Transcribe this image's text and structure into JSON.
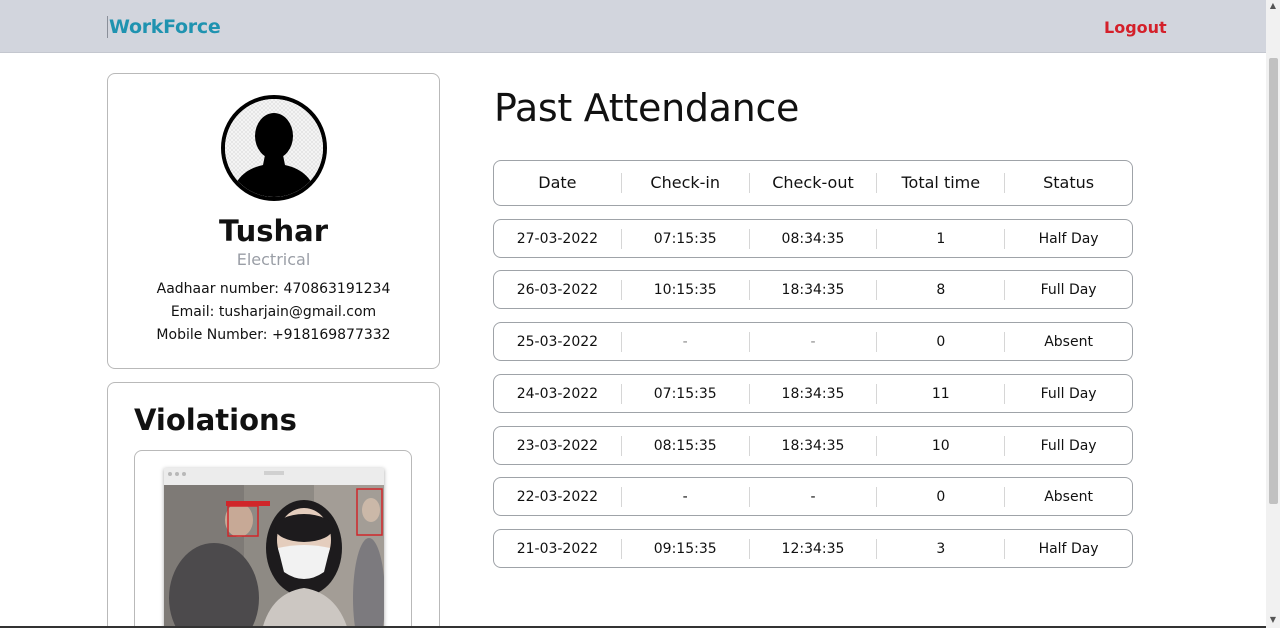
{
  "nav": {
    "brand": "WorkForce",
    "logout": "Logout"
  },
  "profile": {
    "name": "Tushar",
    "department": "Electrical",
    "aadhaar": "Aadhaar number: 470863191234",
    "email": "Email: tusharjain@gmail.com",
    "mobile": "Mobile Number: +918169877332",
    "avatar_icon": "user-silhouette-icon"
  },
  "violations": {
    "title": "Violations"
  },
  "attendance": {
    "title": "Past Attendance",
    "columns": [
      "Date",
      "Check-in",
      "Check-out",
      "Total time",
      "Status"
    ],
    "rows": [
      {
        "date": "27-03-2022",
        "check_in": "07:15:35",
        "check_out": "08:34:35",
        "total": "1",
        "status": "Half Day"
      },
      {
        "date": "26-03-2022",
        "check_in": "10:15:35",
        "check_out": "18:34:35",
        "total": "8",
        "status": "Full Day"
      },
      {
        "date": "25-03-2022",
        "check_in": "-",
        "check_out": "-",
        "total": "0",
        "status": "Absent"
      },
      {
        "date": "24-03-2022",
        "check_in": "07:15:35",
        "check_out": "18:34:35",
        "total": "11",
        "status": "Full Day"
      },
      {
        "date": "23-03-2022",
        "check_in": "08:15:35",
        "check_out": "18:34:35",
        "total": "10",
        "status": "Full Day"
      },
      {
        "date": "22-03-2022",
        "check_in": "-",
        "check_out": "-",
        "total": "0",
        "status": "Absent"
      },
      {
        "date": "21-03-2022",
        "check_in": "09:15:35",
        "check_out": "12:34:35",
        "total": "3",
        "status": "Half Day"
      }
    ]
  },
  "colors": {
    "brand": "#1f93b0",
    "logout": "#d4202a",
    "navbar": "#d2d5dd"
  }
}
